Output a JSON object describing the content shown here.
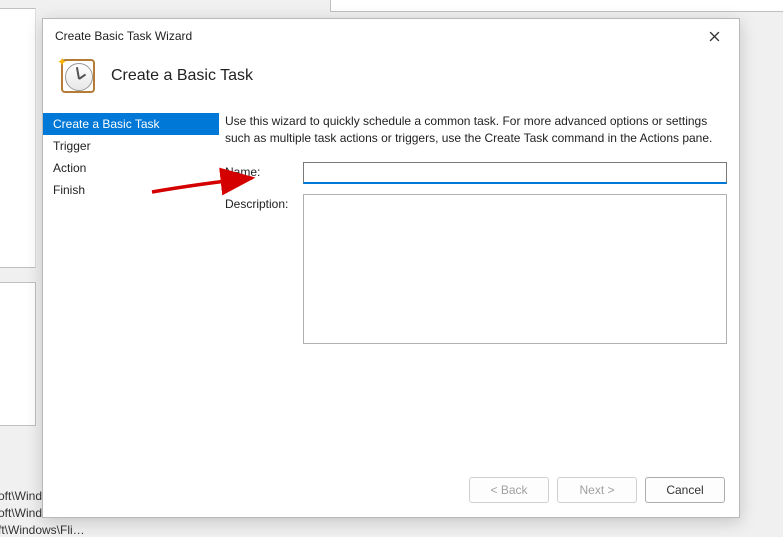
{
  "window": {
    "title": "Create Basic Task Wizard"
  },
  "header": {
    "title": "Create a Basic Task"
  },
  "sidebar": {
    "steps": [
      {
        "label": "Create a Basic Task",
        "selected": true
      },
      {
        "label": "Trigger",
        "selected": false
      },
      {
        "label": "Action",
        "selected": false
      },
      {
        "label": "Finish",
        "selected": false
      }
    ]
  },
  "content": {
    "intro": "Use this wizard to quickly schedule a common task.  For more advanced options or settings such as multiple task actions or triggers, use the Create Task command in the Actions pane.",
    "name_label": "Name:",
    "name_value": "",
    "description_label": "Description:",
    "description_value": ""
  },
  "footer": {
    "back": "< Back",
    "next": "Next >",
    "cancel": "Cancel"
  },
  "background": {
    "line1": "oft\\Windows\\U…",
    "line2": "oft\\Windows\\U…",
    "line3": "ft\\Windows\\Fli…"
  }
}
